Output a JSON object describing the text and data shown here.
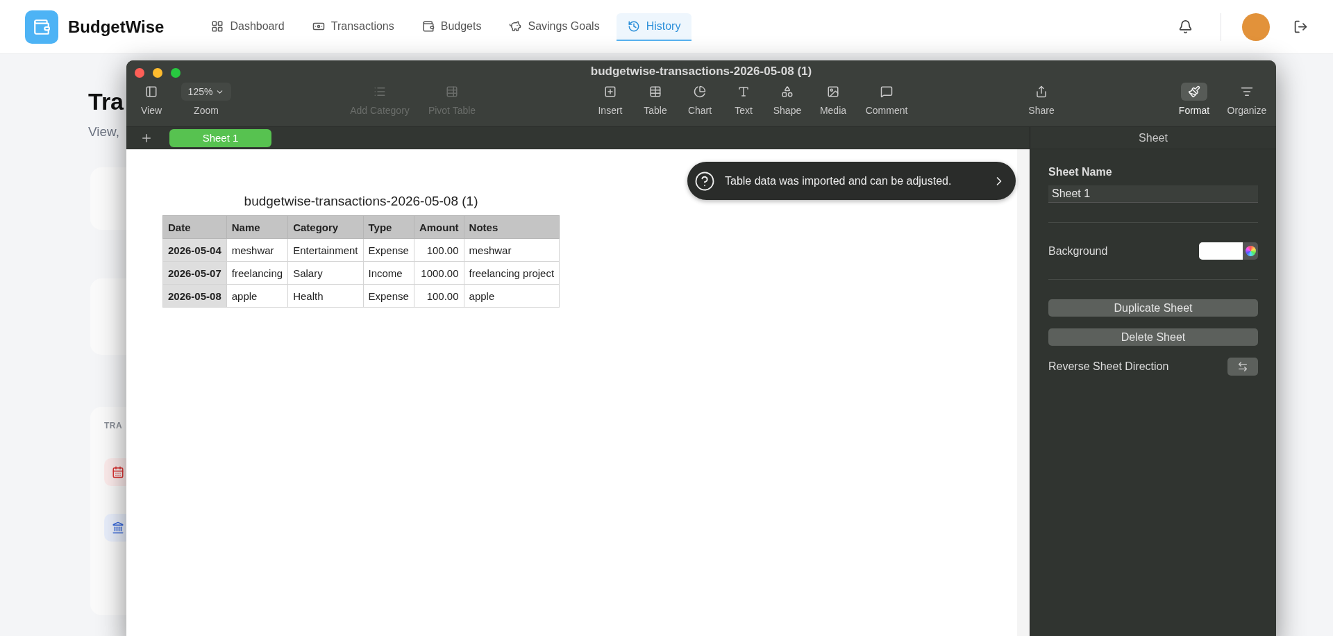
{
  "app": {
    "name": "BudgetWise"
  },
  "nav": [
    {
      "label": "Dashboard",
      "kind": "dashboard",
      "selected": false
    },
    {
      "label": "Transactions",
      "kind": "transactions",
      "selected": false
    },
    {
      "label": "Budgets",
      "kind": "budgets",
      "selected": false
    },
    {
      "label": "Savings Goals",
      "kind": "savings",
      "selected": false
    },
    {
      "label": "History",
      "kind": "history",
      "selected": true
    }
  ],
  "background_page": {
    "title": "Tra",
    "subtitle": "View,",
    "section_label": "TRA"
  },
  "window": {
    "title": "budgetwise-transactions-2026-05-08 (1)"
  },
  "toolbar": [
    {
      "label": "View",
      "kind": "view",
      "disabled": false,
      "selected": false
    },
    {
      "label": "Zoom",
      "kind": "zoom",
      "value": "125%",
      "disabled": false,
      "selected": false
    },
    {
      "label": "Add Category",
      "kind": "category",
      "disabled": true,
      "selected": false
    },
    {
      "label": "Pivot Table",
      "kind": "pivot",
      "disabled": true,
      "selected": false
    },
    {
      "label": "Insert",
      "kind": "insert",
      "disabled": false,
      "selected": false
    },
    {
      "label": "Table",
      "kind": "table",
      "disabled": false,
      "selected": false
    },
    {
      "label": "Chart",
      "kind": "chart",
      "disabled": false,
      "selected": false
    },
    {
      "label": "Text",
      "kind": "text",
      "disabled": false,
      "selected": false
    },
    {
      "label": "Shape",
      "kind": "shape",
      "disabled": false,
      "selected": false
    },
    {
      "label": "Media",
      "kind": "media",
      "disabled": false,
      "selected": false
    },
    {
      "label": "Comment",
      "kind": "comment",
      "disabled": false,
      "selected": false
    },
    {
      "label": "Share",
      "kind": "share",
      "disabled": false,
      "selected": false
    },
    {
      "label": "Format",
      "kind": "format",
      "disabled": false,
      "selected": true
    },
    {
      "label": "Organize",
      "kind": "organize",
      "disabled": false,
      "selected": false
    }
  ],
  "sheet_tabs": [
    {
      "label": "Sheet 1",
      "selected": true
    }
  ],
  "notice": "Table data was imported and can be adjusted.",
  "table": {
    "title": "budgetwise-transactions-2026-05-08 (1)",
    "columns": [
      "Date",
      "Name",
      "Category",
      "Type",
      "Amount",
      "Notes"
    ],
    "rows": [
      [
        "2026-05-04",
        "meshwar",
        "Entertainment",
        "Expense",
        "100.00",
        "meshwar"
      ],
      [
        "2026-05-07",
        "freelancing",
        "Salary",
        "Income",
        "1000.00",
        "freelancing project"
      ],
      [
        "2026-05-08",
        "apple",
        "Health",
        "Expense",
        "100.00",
        "apple"
      ]
    ]
  },
  "inspector": {
    "heading": "Sheet",
    "sheet_name_label": "Sheet Name",
    "sheet_name": "Sheet 1",
    "background_label": "Background",
    "buttons": [
      "Duplicate Sheet",
      "Delete Sheet"
    ],
    "reverse_label": "Reverse Sheet Direction"
  }
}
